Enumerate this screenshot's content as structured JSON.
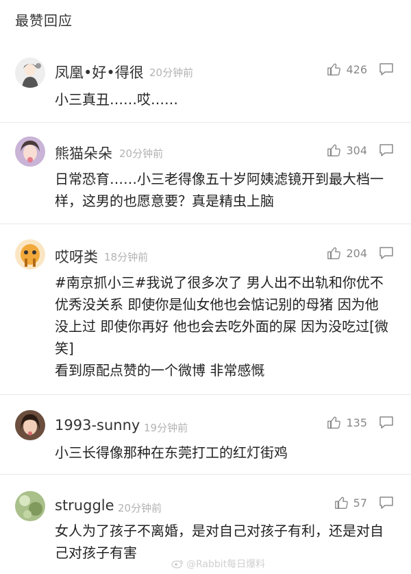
{
  "section": {
    "title": "最赞回应"
  },
  "comments": [
    {
      "username": "凤凰•好•得很",
      "time": "20分钟前",
      "likes": "426",
      "content": "小三真丑……哎……"
    },
    {
      "username": "熊猫朵朵",
      "time": "20分钟前",
      "likes": "304",
      "content": "日常恐育……小三老得像五十岁阿姨滤镜开到最大档一样，这男的也愿意要？真是精虫上脑"
    },
    {
      "username": "哎呀类",
      "time": "18分钟前",
      "likes": "204",
      "content": "#南京抓小三#我说了很多次了 男人出不出轨和你优不优秀没关系 即使你是仙女他也会惦记别的母猪 因为他没上过 即使你再好 他也会去吃外面的屎 因为没吃过[微笑]\n看到原配点赞的一个微博 非常感慨"
    },
    {
      "username": "1993-sunny",
      "time": "19分钟前",
      "likes": "135",
      "content": "小三长得像那种在东莞打工的红灯街鸡"
    },
    {
      "username": "struggle",
      "time": "20分钟前",
      "likes": "57",
      "content": "女人为了孩子不离婚，是对自己对孩子有利，还是对自己对孩子有害"
    }
  ],
  "watermark": {
    "text": "@Rabbit每日爆料"
  },
  "icons": {
    "like": "thumbs-up-icon",
    "reply": "comment-bubble-icon"
  }
}
